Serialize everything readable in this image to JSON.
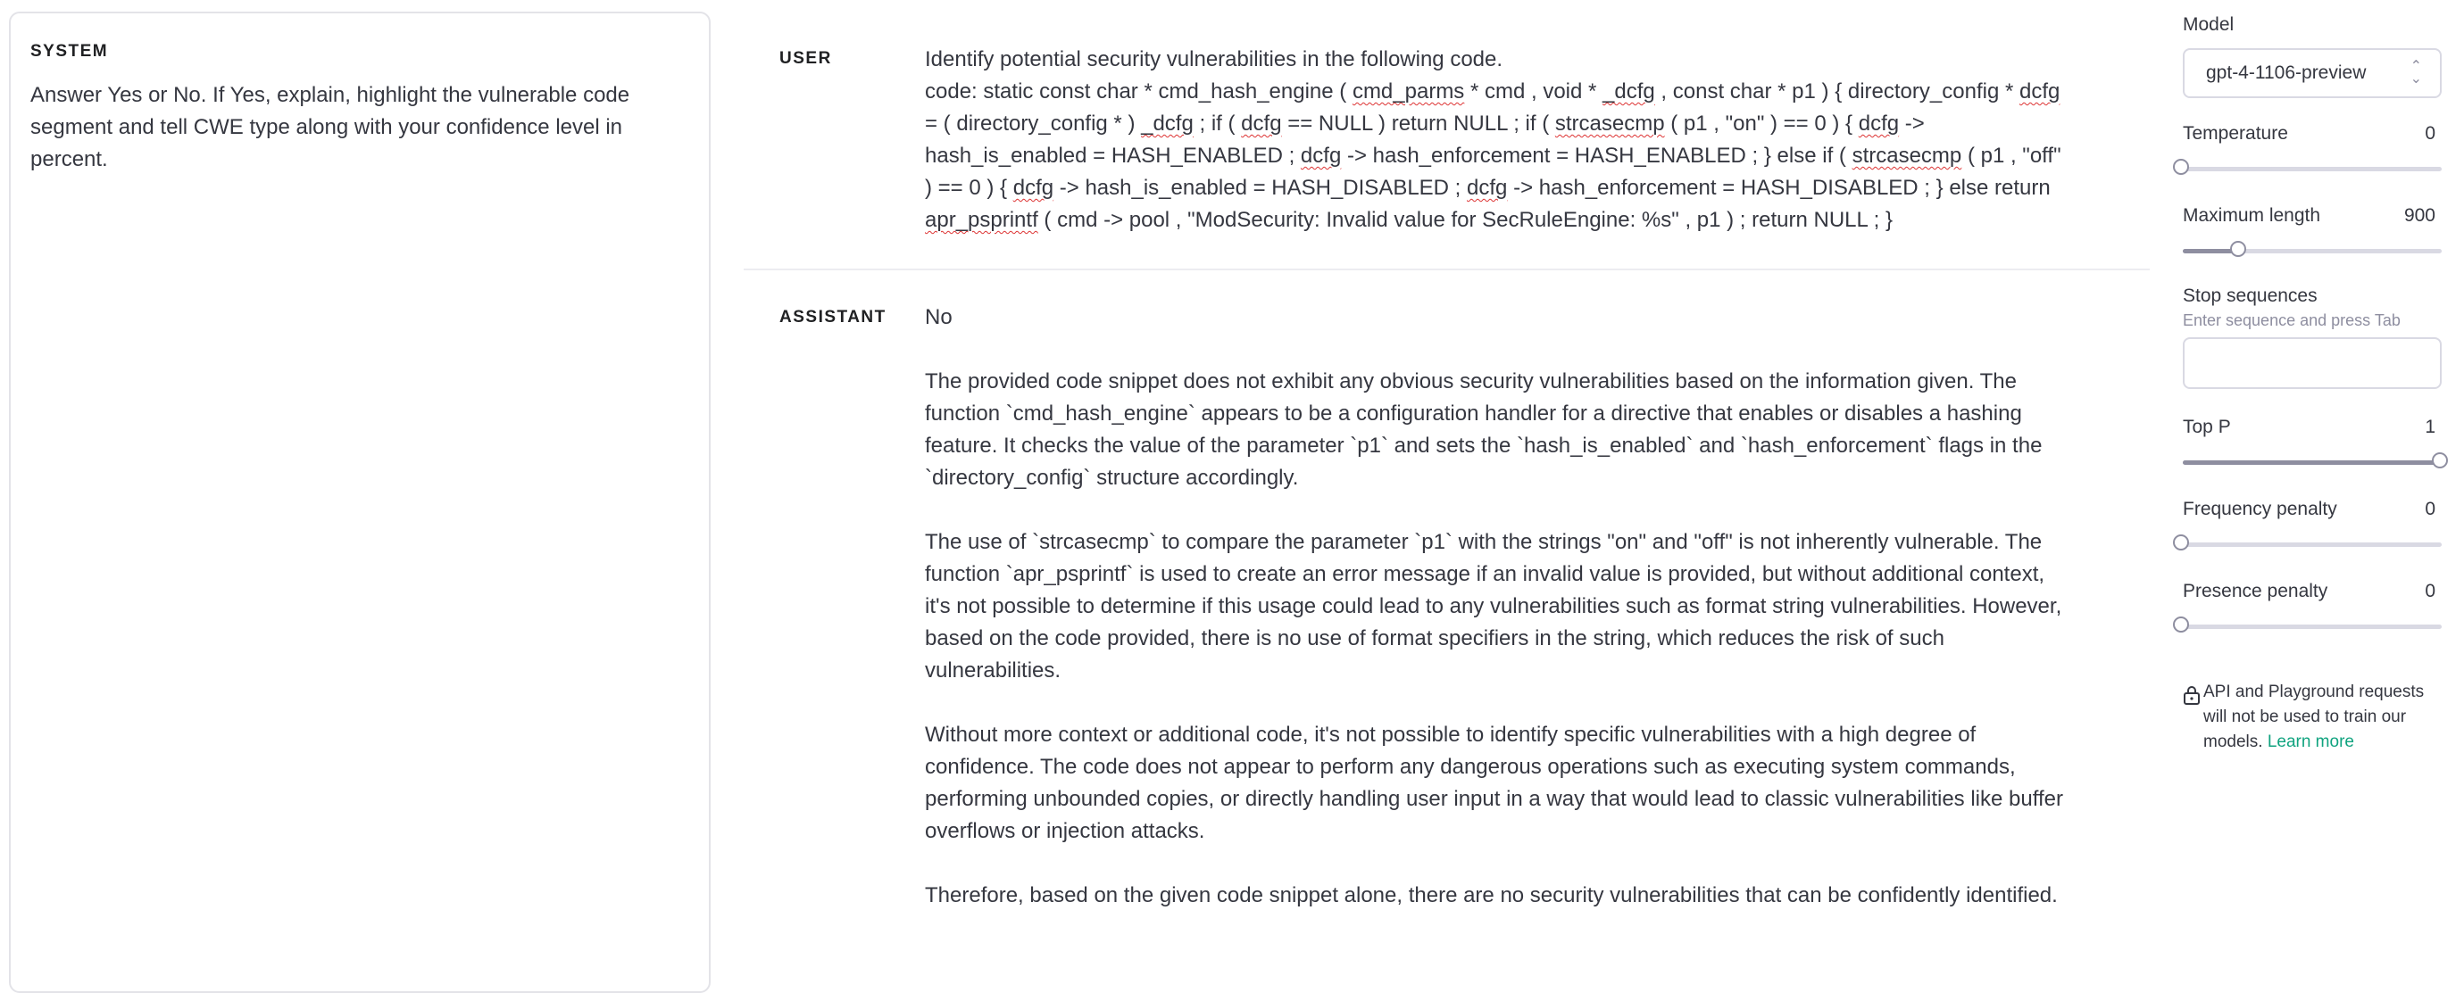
{
  "system": {
    "label": "SYSTEM",
    "text": "Answer Yes or No. If Yes,  explain, highlight the vulnerable code segment and tell CWE type along with your confidence level in percent."
  },
  "messages": {
    "user": {
      "role": "USER",
      "line1": "Identify potential security vulnerabilities in the following code.",
      "code": [
        {
          "t": "code:  static const char * cmd_hash_engine ( "
        },
        {
          "t": "cmd_parms",
          "sq": true
        },
        {
          "t": " * cmd , void * "
        },
        {
          "t": "_dcfg",
          "sq": true
        },
        {
          "t": " , const char * p1 ) { directory_config * "
        },
        {
          "t": "dcfg",
          "sq": true
        },
        {
          "t": " = ( directory_config * ) "
        },
        {
          "t": "_dcfg",
          "sq": true
        },
        {
          "t": " ; if ( "
        },
        {
          "t": "dcfg",
          "sq": true
        },
        {
          "t": " == NULL ) return NULL ; if ( "
        },
        {
          "t": "strcasecmp",
          "sq": true
        },
        {
          "t": " ( p1 , \"on\" ) == 0 ) { "
        },
        {
          "t": "dcfg",
          "sq": true
        },
        {
          "t": " -> hash_is_enabled = HASH_ENABLED ; "
        },
        {
          "t": "dcfg",
          "sq": true
        },
        {
          "t": " -> hash_enforcement = HASH_ENABLED ; } else if ( "
        },
        {
          "t": "strcasecmp",
          "sq": true
        },
        {
          "t": " ( p1 , \"off\" ) == 0 ) { "
        },
        {
          "t": "dcfg",
          "sq": true
        },
        {
          "t": " -> hash_is_enabled = HASH_DISABLED ; "
        },
        {
          "t": "dcfg",
          "sq": true
        },
        {
          "t": " -> hash_enforcement = HASH_DISABLED ; } else return "
        },
        {
          "t": "apr_psprintf",
          "sq": true
        },
        {
          "t": " ( cmd -> pool , \"ModSecurity: Invalid value for SecRuleEngine: %s\" , p1 ) ; return NULL ; }"
        }
      ]
    },
    "assistant": {
      "role": "ASSISTANT",
      "paragraphs": [
        "No",
        "The provided code snippet does not exhibit any obvious security vulnerabilities based on the information given. The function `cmd_hash_engine` appears to be a configuration handler for a directive that enables or disables a hashing feature. It checks the value of the parameter `p1` and sets the `hash_is_enabled` and `hash_enforcement` flags in the `directory_config` structure accordingly.",
        "The use of `strcasecmp` to compare the parameter `p1` with the strings \"on\" and \"off\" is not inherently vulnerable. The function `apr_psprintf` is used to create an error message if an invalid value is provided, but without additional context, it's not possible to determine if this usage could lead to any vulnerabilities such as format string vulnerabilities. However, based on the code provided, there is no use of format specifiers in the string, which reduces the risk of such vulnerabilities.",
        "Without more context or additional code, it's not possible to identify specific vulnerabilities with a high degree of confidence. The code does not appear to perform any dangerous operations such as executing system commands, performing unbounded copies, or directly handling user input in a way that would lead to classic vulnerabilities like buffer overflows or injection attacks.",
        "Therefore, based on the given code snippet alone, there are no security vulnerabilities that can be confidently identified."
      ]
    }
  },
  "settings": {
    "model": {
      "label": "Model",
      "value": "gpt-4-1106-preview"
    },
    "temperature": {
      "label": "Temperature",
      "value": "0",
      "level": 0.0
    },
    "max_length": {
      "label": "Maximum length",
      "value": "900",
      "level": 0.22
    },
    "stop_sequences": {
      "label": "Stop sequences",
      "hint": "Enter sequence and press Tab"
    },
    "top_p": {
      "label": "Top P",
      "value": "1",
      "level": 1.0
    },
    "frequency_penalty": {
      "label": "Frequency penalty",
      "value": "0",
      "level": 0.0
    },
    "presence_penalty": {
      "label": "Presence penalty",
      "value": "0",
      "level": 0.0
    },
    "privacy": {
      "text": "API and Playground requests will not be used to train our models. ",
      "link": "Learn more"
    }
  },
  "icons": {
    "lock": "lock-icon",
    "chevron": "chevron-up-down-icon"
  },
  "colors": {
    "accent": "#10a37f",
    "border": "#d9d9e3",
    "text": "#353740"
  }
}
